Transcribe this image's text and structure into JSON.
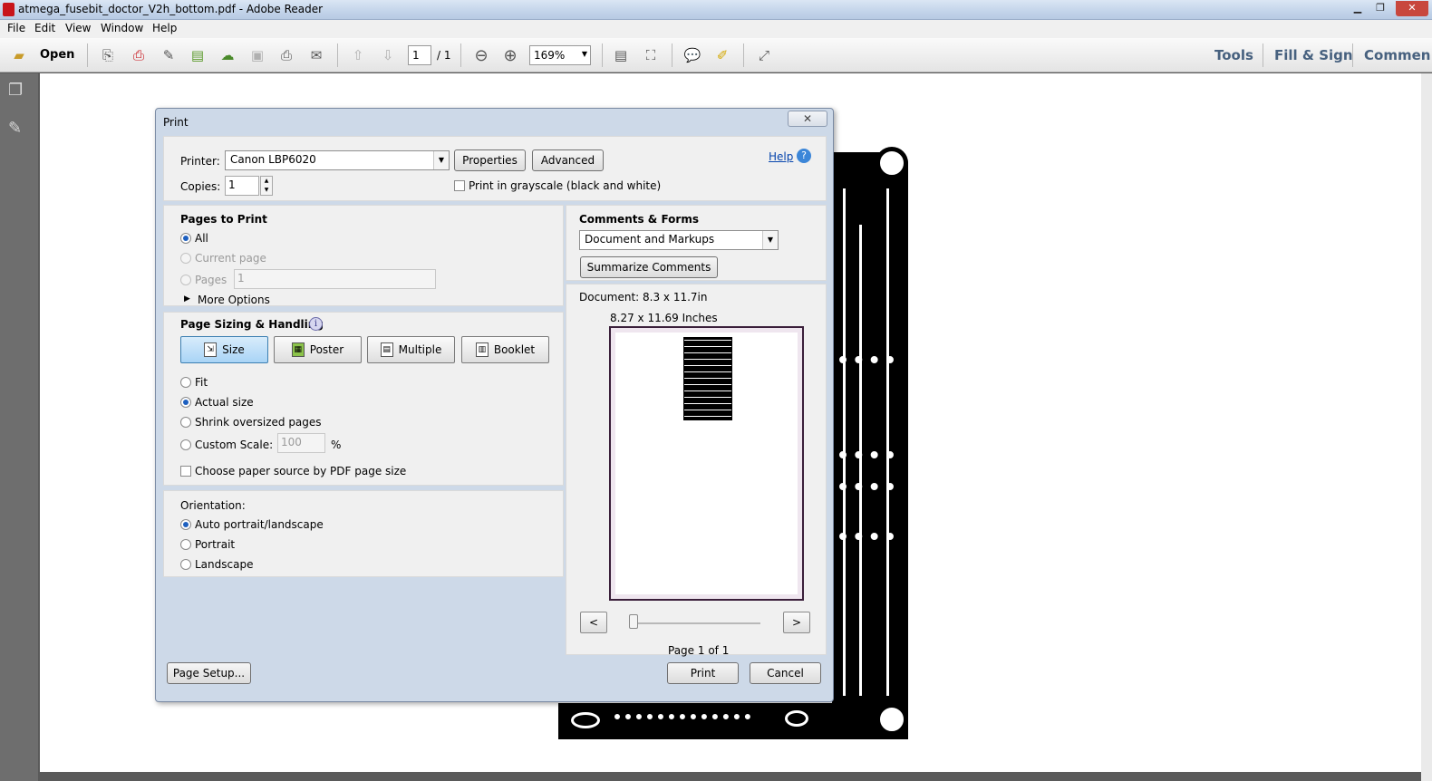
{
  "window": {
    "title": "atmega_fusebit_doctor_V2h_bottom.pdf - Adobe Reader",
    "controls": [
      "minimize",
      "restore",
      "close"
    ]
  },
  "menu": [
    "File",
    "Edit",
    "View",
    "Window",
    "Help"
  ],
  "toolbar": {
    "open_label": "Open",
    "page_current": "1",
    "page_total": "/ 1",
    "zoom": "169%",
    "right_links": [
      "Tools",
      "Fill & Sign",
      "Commen"
    ]
  },
  "dialog": {
    "title": "Print",
    "close_label": "✕",
    "printer_label": "Printer:",
    "printer_value": "Canon LBP6020",
    "properties_label": "Properties",
    "advanced_label": "Advanced",
    "help_label": "Help",
    "copies_label": "Copies:",
    "copies_value": "1",
    "grayscale_label": "Print in grayscale (black and white)",
    "pages_to_print": {
      "heading": "Pages to Print",
      "all": "All",
      "current_page": "Current page",
      "pages": "Pages",
      "pages_value": "1",
      "more_options": "More Options"
    },
    "sizing": {
      "heading": "Page Sizing & Handling",
      "modes": [
        "Size",
        "Poster",
        "Multiple",
        "Booklet"
      ],
      "fit": "Fit",
      "actual_size": "Actual size",
      "shrink": "Shrink oversized pages",
      "custom_scale": "Custom Scale:",
      "custom_scale_value": "100",
      "percent": "%",
      "paper_source": "Choose paper source by PDF page size"
    },
    "orientation": {
      "heading": "Orientation:",
      "auto": "Auto portrait/landscape",
      "portrait": "Portrait",
      "landscape": "Landscape"
    },
    "comments": {
      "heading": "Comments & Forms",
      "value": "Document and Markups",
      "summarize": "Summarize Comments"
    },
    "preview": {
      "document_size": "Document: 8.3 x 11.7in",
      "paper_size": "8.27 x 11.69 Inches",
      "prev": "<",
      "next": ">",
      "page_label": "Page 1 of 1"
    },
    "page_setup_label": "Page Setup...",
    "print_label": "Print",
    "cancel_label": "Cancel"
  },
  "colors": {
    "dialog_frame": "#cdd9e8",
    "pane": "#f0f0f0",
    "selected_mode": "#a9d4f6",
    "link": "#0645ad",
    "toolbar_links": "#47617f"
  }
}
